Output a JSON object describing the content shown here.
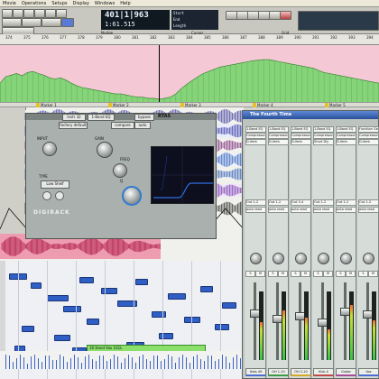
{
  "menu": [
    "Movie",
    "Operations",
    "Setups",
    "Display",
    "Windows",
    "Help"
  ],
  "transport": {
    "counter_main": "401|1|963",
    "counter_sub": "1:61.515",
    "start_label": "Start",
    "end_label": "End",
    "length_label": "Length",
    "nudge_label": "Nudge",
    "cursor_label": "Cursor",
    "grid_label": "Grid"
  },
  "ruler": {
    "ticks": [
      "374",
      "375",
      "376",
      "377",
      "378",
      "379",
      "380",
      "381",
      "382",
      "383",
      "384",
      "385",
      "386",
      "387",
      "388",
      "389",
      "390",
      "391",
      "392",
      "393",
      "394"
    ]
  },
  "markers": [
    {
      "label": "Marker 1"
    },
    {
      "label": "Marker 2"
    },
    {
      "label": "Marker 3"
    },
    {
      "label": "Marker 4"
    },
    {
      "label": "Marker 5"
    }
  ],
  "plugin": {
    "title": "RTAS",
    "brand": "DIGIRACK",
    "preset": "factory default",
    "compare": "compare",
    "auto": "auto",
    "bypass": "bypass",
    "knob_labels": [
      "INPUT",
      "GAIN",
      "FREQ",
      "Q"
    ],
    "type_label": "TYPE",
    "type_value": "Low Shelf",
    "track_name": "Instr 32",
    "insert": "1-Band EQ"
  },
  "mixer": {
    "title": "The Fourth Time",
    "strips": [
      {
        "name": "Hats 49",
        "inserts": [
          "1-Band EQ",
          "Compressor",
          "D-Verb"
        ],
        "io": "Out 1-2",
        "vol": "auto read",
        "level": 0.62,
        "mlevel": 0.55,
        "color": "#4c6cd2"
      },
      {
        "name": "OH 1-10",
        "inserts": [
          "1-Band EQ",
          "Compressor",
          "D-Verb"
        ],
        "io": "Out 1-2",
        "vol": "auto read",
        "level": 0.55,
        "mlevel": 0.72,
        "color": "#3c9a4a"
      },
      {
        "name": "OH 2-10",
        "inserts": [
          "1-Band EQ",
          "Compressor",
          "D-Verb"
        ],
        "io": "Out 3-4",
        "vol": "auto read",
        "level": 0.58,
        "mlevel": 0.62,
        "color": "#d4a828"
      },
      {
        "name": "Kick 4",
        "inserts": [
          "1-Band EQ",
          "Compressor",
          "Short Dly"
        ],
        "io": "Out 1-2",
        "vol": "auto read",
        "level": 0.5,
        "mlevel": 0.45,
        "color": "#c04848"
      },
      {
        "name": "Guitar",
        "inserts": [
          "1-Band EQ",
          "Compressor",
          "D-Verb"
        ],
        "io": "Out 1-2",
        "vol": "auto read",
        "level": 0.64,
        "mlevel": 0.8,
        "color": "#a84898"
      },
      {
        "name": "Vox",
        "inserts": [
          "Function Gen",
          "Compressor",
          "D-Verb"
        ],
        "io": "Out 1-2",
        "vol": "auto read",
        "level": 0.6,
        "mlevel": 0.58,
        "color": "#4c6cd2"
      }
    ],
    "strip_btns": [
      "S",
      "M"
    ],
    "auto_label": "auto read"
  },
  "region_label": "16 Hand Vox 161L",
  "chart_data": {
    "type": "area",
    "title": "",
    "series": [
      {
        "values": [
          40,
          52,
          55,
          58,
          54,
          60,
          62,
          58,
          55,
          50,
          48,
          50,
          46,
          40,
          35,
          32,
          30,
          28,
          26,
          24,
          22,
          20,
          20,
          18,
          16,
          14,
          14,
          12,
          12,
          10,
          12,
          14,
          20,
          30,
          38,
          45,
          52,
          58,
          62,
          66,
          70,
          72,
          74,
          76,
          78,
          80,
          82,
          83,
          84,
          84,
          82,
          80,
          78,
          76,
          74,
          72,
          70,
          68,
          64,
          60,
          58,
          56,
          54,
          52,
          50,
          48,
          46,
          44,
          42,
          40
        ]
      }
    ],
    "ylim": [
      0,
      100
    ]
  }
}
